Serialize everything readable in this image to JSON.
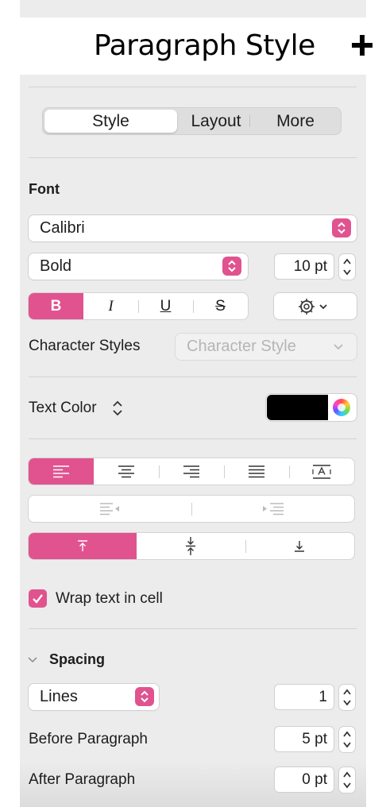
{
  "header": {
    "title": "Paragraph Style"
  },
  "tabs": [
    {
      "label": "Style"
    },
    {
      "label": "Layout"
    },
    {
      "label": "More"
    }
  ],
  "font": {
    "section_label": "Font",
    "family": "Calibri",
    "typeface": "Bold",
    "size": "10 pt",
    "bold_label": "B",
    "italic_label": "I",
    "underline_label": "U",
    "strike_label": "S",
    "character_styles_label": "Character Styles",
    "character_style_placeholder": "Character Style"
  },
  "text_color": {
    "label": "Text Color",
    "swatch": "#000000"
  },
  "alignment": {
    "active": "left",
    "vertical_active": "top"
  },
  "wrap": {
    "label": "Wrap text in cell",
    "checked": true
  },
  "spacing": {
    "section_label": "Spacing",
    "mode": "Lines",
    "value": "1",
    "before_label": "Before Paragraph",
    "before_value": "5 pt",
    "after_label": "After Paragraph",
    "after_value": "0 pt"
  },
  "colors": {
    "accent": "#e0538f",
    "panel": "#ececec"
  }
}
